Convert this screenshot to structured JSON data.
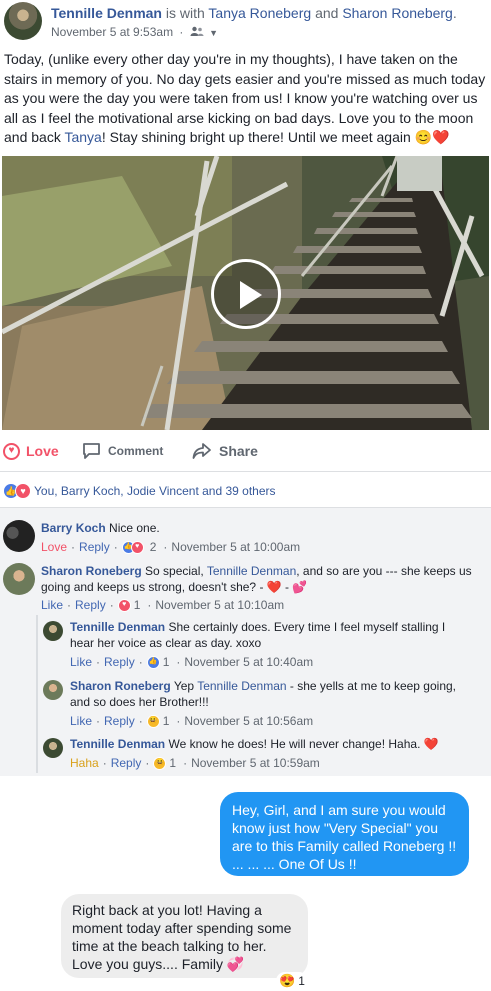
{
  "post": {
    "author": "Tennille Denman",
    "is_with": "is with",
    "tag1": "Tanya Roneberg",
    "and": "and",
    "tag2": "Sharon Roneberg",
    "period": ".",
    "timestamp": "November 5 at 9:53am",
    "audience_icon": "friends-icon",
    "text_before_link": "Today, (unlike every other day you're in my thoughts), I have taken on the stairs in memory of you. No day gets easier and you're missed as much today as you were the day you were taken from us! I know you're watching over us all as I feel the motivational arse kicking on bad days. Love you to the moon and back ",
    "text_link": "Tanya",
    "text_after_link": "! Stay shining bright up there! Until we meet again ",
    "text_emoji": "😊❤️"
  },
  "actions": {
    "love": "Love",
    "comment": "Comment",
    "share": "Share"
  },
  "reactions_summary": "You, Barry Koch, Jodie Vincent and 39 others",
  "comments": [
    {
      "name": "Barry Koch",
      "text": "Nice one.",
      "reaction_label": "Love",
      "reply": "Reply",
      "count": "2",
      "time": "November 5 at 10:00am"
    },
    {
      "name": "Sharon Roneberg",
      "text_before": "So special, ",
      "link": "Tennille Denman",
      "text_after": ", and so are you --- she keeps us going and keeps us strong, doesn't she? - ❤️ - 💕",
      "reaction_label": "Like",
      "reply": "Reply",
      "count": "1",
      "time": "November 5 at 10:10am"
    }
  ],
  "replies": [
    {
      "name": "Tennille Denman",
      "text": "She certainly does. Every time I feel myself stalling I hear her voice as clear as day. xoxo",
      "reaction_label": "Like",
      "reply": "Reply",
      "count": "1",
      "time": "November 5 at 10:40am"
    },
    {
      "name": "Sharon Roneberg",
      "text_before": "Yep ",
      "link": "Tennille Denman",
      "text_after": " - she yells at me to keep going, and so does her Brother!!!",
      "reaction_label": "Like",
      "reply": "Reply",
      "count": "1",
      "time": "November 5 at 10:56am"
    },
    {
      "name": "Tennille Denman",
      "text": "We know he does! He will never change! Haha. ❤️",
      "reaction_label": "Haha",
      "reply": "Reply",
      "count": "1",
      "time": "November 5 at 10:59am"
    }
  ],
  "chat": {
    "outgoing": "Hey, Girl, and I am sure you would know just how \"Very Special\" you are to this Family called Roneberg !! ... ... ... One Of Us !!",
    "incoming": "Right back at you lot! Having a moment today after spending some time at the beach talking to her. Love you guys.... Family 💞",
    "reaction_emoji": "😍",
    "reaction_count": "1"
  },
  "colors": {
    "link": "#365899",
    "love": "#f25268",
    "like": "#4b7be5",
    "haha": "#f7b928",
    "bubble_out": "#2196f3",
    "bubble_in": "#ededed",
    "comments_bg": "#f2f3f5"
  }
}
